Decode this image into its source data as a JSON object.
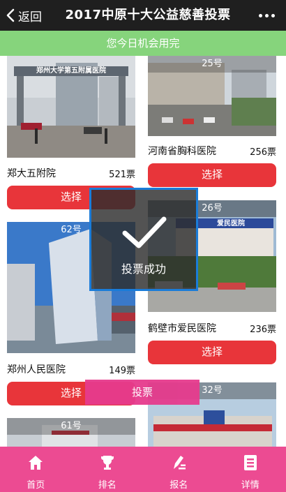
{
  "header": {
    "back_label": "返回",
    "title": "2017中原十大公益慈善投票",
    "more_icon": "more-dots-icon"
  },
  "banner": {
    "text": "您今日机会用完"
  },
  "candidates": [
    {
      "number": "",
      "name": "郑大五附院",
      "votes": "521票",
      "select_label": "选择",
      "photo_sign": "郑州大学第五附属医院"
    },
    {
      "number": "25号",
      "name": "河南省胸科医院",
      "votes": "256票",
      "select_label": "选择"
    },
    {
      "number": "62号",
      "name": "郑州人民医院",
      "votes": "149票",
      "select_label": "选择"
    },
    {
      "number": "26号",
      "name": "鹤壁市爱民医院",
      "votes": "236票",
      "select_label": "选择",
      "photo_sign": "爱民医院"
    },
    {
      "number": "61号"
    },
    {
      "number": "32号"
    }
  ],
  "vote_bar": {
    "label": "投票"
  },
  "toast": {
    "message": "投票成功",
    "icon": "checkmark-icon"
  },
  "nav": {
    "items": [
      {
        "label": "首页",
        "icon": "home-icon"
      },
      {
        "label": "排名",
        "icon": "trophy-icon"
      },
      {
        "label": "报名",
        "icon": "signup-pen-icon"
      },
      {
        "label": "详情",
        "icon": "details-doc-icon"
      }
    ]
  },
  "colors": {
    "header_bg": "#1f1f1f",
    "banner_bg": "#86d47c",
    "select_button": "#e8353a",
    "vote_bar": "#e63b8d",
    "bottom_nav": "#ec4b92",
    "toast_border": "#1a7cd9"
  }
}
